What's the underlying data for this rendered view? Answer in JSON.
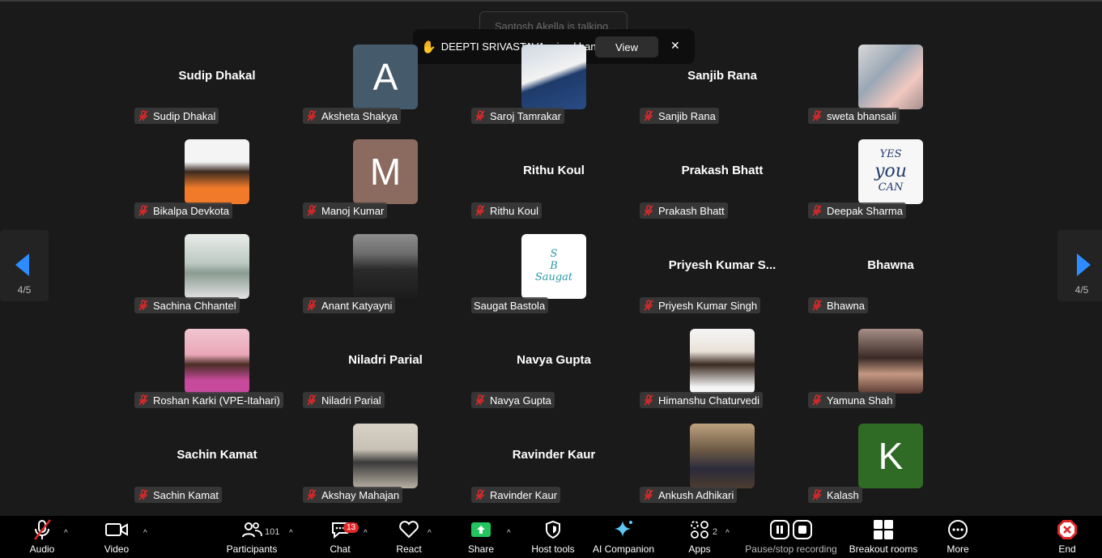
{
  "notifications": {
    "talking": "Santosh Akella is talking...",
    "raised_hand_text": "DEEPTI SRIVASTAVA raised hand",
    "view_label": "View",
    "close_glyph": "✕"
  },
  "pager": {
    "left_label": "4/5",
    "right_label": "4/5"
  },
  "participants": [
    {
      "label": "Sudip Dhakal",
      "bigname": "Sudip Dhakal",
      "avatar": "none"
    },
    {
      "label": "Aksheta Shakya",
      "letter": "A",
      "avatar_color": "#455a6b"
    },
    {
      "label": "Saroj Tamrakar",
      "avatar": "photo"
    },
    {
      "label": "Sanjib Rana",
      "bigname": "Sanjib Rana",
      "avatar": "none"
    },
    {
      "label": "sweta bhansali",
      "avatar": "photo"
    },
    {
      "label": "Bikalpa Devkota",
      "avatar": "photo"
    },
    {
      "label": "Manoj Kumar",
      "letter": "M",
      "avatar_color": "#8b6a5f"
    },
    {
      "label": "Rithu Koul",
      "bigname": "Rithu Koul",
      "avatar": "none"
    },
    {
      "label": "Prakash Bhatt",
      "bigname": "Prakash Bhatt",
      "avatar": "none"
    },
    {
      "label": "Deepak Sharma",
      "avatar": "photo",
      "photo_text": [
        "YES",
        "you",
        "CAN"
      ]
    },
    {
      "label": "Sachina Chhantel",
      "avatar": "photo"
    },
    {
      "label": "Anant Katyayni",
      "avatar": "photo"
    },
    {
      "label": "Saugat Bastola",
      "avatar": "photo",
      "photo_text": [
        "S",
        "B",
        "Saugat"
      ]
    },
    {
      "label": "Priyesh Kumar Singh",
      "bigname": "Priyesh  Kumar  S...",
      "avatar": "none"
    },
    {
      "label": "Bhawna",
      "bigname": "Bhawna",
      "avatar": "none"
    },
    {
      "label": "Roshan Karki (VPE-Itahari)",
      "avatar": "photo"
    },
    {
      "label": "Niladri Parial",
      "bigname": "Niladri Parial",
      "avatar": "none"
    },
    {
      "label": "Navya Gupta",
      "bigname": "Navya Gupta",
      "avatar": "none"
    },
    {
      "label": "Himanshu Chaturvedi",
      "avatar": "photo"
    },
    {
      "label": "Yamuna Shah",
      "avatar": "photo"
    },
    {
      "label": "Sachin Kamat",
      "bigname": "Sachin Kamat",
      "avatar": "none"
    },
    {
      "label": "Akshay Mahajan",
      "avatar": "photo"
    },
    {
      "label": "Ravinder Kaur",
      "bigname": "Ravinder Kaur",
      "avatar": "none"
    },
    {
      "label": "Ankush Adhikari",
      "avatar": "photo"
    },
    {
      "label": "Kalash",
      "letter": "K",
      "avatar_color": "#2f6b25"
    }
  ],
  "toolbar": {
    "audio": "Audio",
    "video": "Video",
    "participants": "Participants",
    "participants_count": "101",
    "chat": "Chat",
    "chat_badge": "13",
    "react": "React",
    "share": "Share",
    "host_tools": "Host tools",
    "ai_companion": "AI Companion",
    "apps": "Apps",
    "apps_count": "2",
    "recording": "Pause/stop recording",
    "breakout": "Breakout rooms",
    "more": "More",
    "end": "End"
  },
  "colors": {
    "accent_blue": "#2d8cff",
    "mute_red": "#e02828",
    "share_green": "#22c55e"
  }
}
